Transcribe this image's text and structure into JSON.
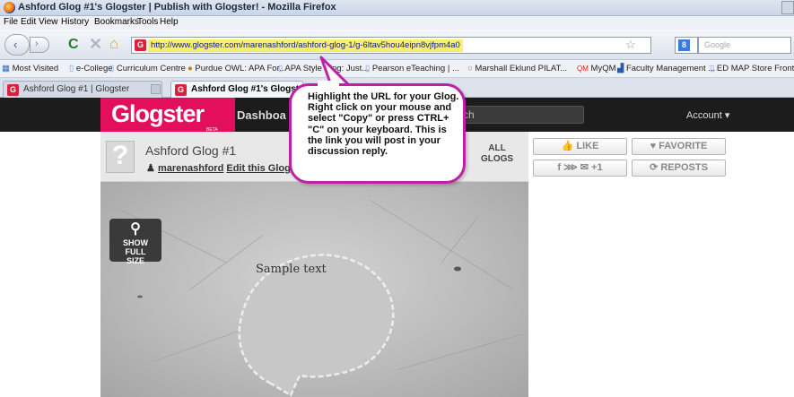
{
  "window": {
    "title": "Ashford Glog #1's Glogster | Publish with Glogster! - Mozilla Firefox"
  },
  "menu": [
    "File",
    "Edit",
    "View",
    "History",
    "Bookmarks",
    "Tools",
    "Help"
  ],
  "nav": {
    "url": "http://www.glogster.com/marenashford/ashford-glog-1/g-6ltav5hou4eipn8vjfpm4a0",
    "search_placeholder": "Google"
  },
  "bookmarks": [
    "Most Visited",
    "e-College",
    "Curriculum Centre",
    "Purdue OWL: APA For...",
    "APA Style Blog: Just...",
    "Pearson eTeaching | ...",
    "Marshall Eklund PILAT...",
    "MyQM",
    "Faculty Management ...",
    "ED MAP Store Front"
  ],
  "tabs": [
    {
      "label": "Ashford Glog #1 | Glogster"
    },
    {
      "label": "Ashford Glog #1's Glogster |"
    }
  ],
  "glogster": {
    "logo": "Glogster",
    "beta": "BETA",
    "dashboard": "Dashboa",
    "search_text": "rch",
    "account": "Account",
    "glog_name": "Ashford Glog #1",
    "username": "marenashford",
    "edit_link": "Edit this Glog",
    "all_glogs": "ALL GLOGS",
    "like": "LIKE",
    "favorite": "FAVORITE",
    "share": "f ⋙ ✉ +1",
    "reposts": "REPOSTS",
    "show_full": "SHOW FULL SIZE",
    "sample": "Sample text"
  },
  "callout": {
    "text": "Highlight the URL for your Glog.  Right click on your mouse and select \"Copy\" or press CTRL+ \"C\" on your keyboard.  This is the link you will post in your discussion reply."
  },
  "colors": {
    "brand": "#e30f5c",
    "callout_border": "#c01fa8",
    "url_highlight": "#f7f06a"
  }
}
